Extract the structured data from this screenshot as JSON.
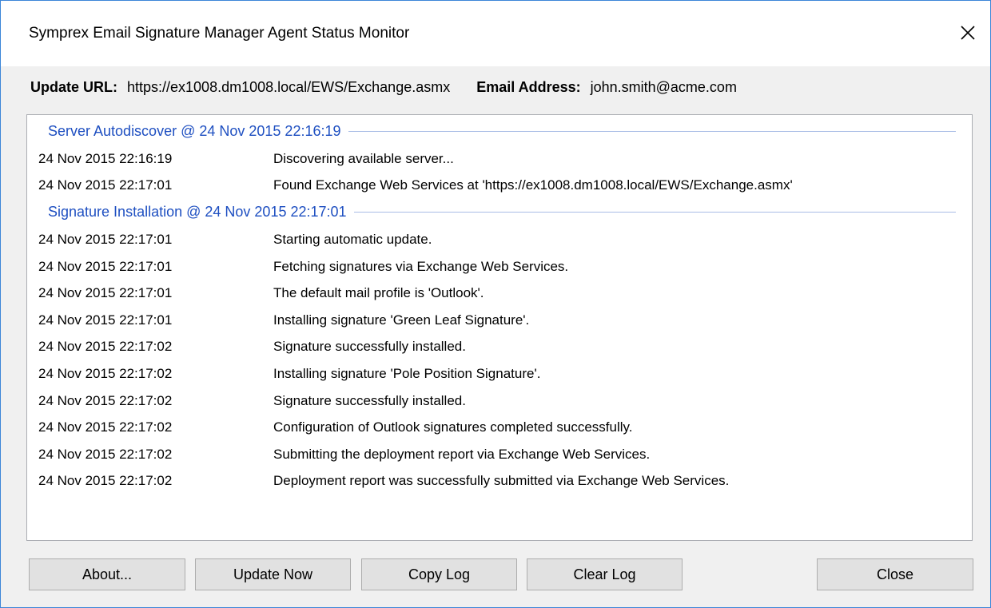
{
  "window": {
    "title": "Symprex Email Signature Manager Agent Status Monitor"
  },
  "info": {
    "update_url_label": "Update URL:",
    "update_url": "https://ex1008.dm1008.local/EWS/Exchange.asmx",
    "email_label": "Email Address:",
    "email": "john.smith@acme.com"
  },
  "log": {
    "groups": [
      {
        "header": "Server Autodiscover @ 24 Nov 2015 22:16:19",
        "entries": [
          {
            "time": "24 Nov 2015 22:16:19",
            "message": "Discovering available server..."
          },
          {
            "time": "24 Nov 2015 22:17:01",
            "message": "Found Exchange Web Services at 'https://ex1008.dm1008.local/EWS/Exchange.asmx'"
          }
        ]
      },
      {
        "header": "Signature Installation @ 24 Nov 2015 22:17:01",
        "entries": [
          {
            "time": "24 Nov 2015 22:17:01",
            "message": "Starting automatic update."
          },
          {
            "time": "24 Nov 2015 22:17:01",
            "message": "Fetching signatures via Exchange Web Services."
          },
          {
            "time": "24 Nov 2015 22:17:01",
            "message": "The default mail profile is 'Outlook'."
          },
          {
            "time": "24 Nov 2015 22:17:01",
            "message": "Installing signature 'Green Leaf Signature'."
          },
          {
            "time": "24 Nov 2015 22:17:02",
            "message": "Signature successfully installed."
          },
          {
            "time": "24 Nov 2015 22:17:02",
            "message": "Installing signature 'Pole Position Signature'."
          },
          {
            "time": "24 Nov 2015 22:17:02",
            "message": "Signature successfully installed."
          },
          {
            "time": "24 Nov 2015 22:17:02",
            "message": "Configuration of Outlook signatures completed successfully."
          },
          {
            "time": "24 Nov 2015 22:17:02",
            "message": "Submitting the deployment report via Exchange Web Services."
          },
          {
            "time": "24 Nov 2015 22:17:02",
            "message": "Deployment report was successfully submitted via Exchange Web Services."
          }
        ]
      }
    ]
  },
  "buttons": {
    "about": "About...",
    "update_now": "Update Now",
    "copy_log": "Copy Log",
    "clear_log": "Clear Log",
    "close": "Close"
  },
  "colors": {
    "window_border": "#3c86d8",
    "group_header": "#1e4fc1",
    "dialog_bg": "#f0f0f0"
  },
  "icons": {
    "close": "close-icon"
  }
}
